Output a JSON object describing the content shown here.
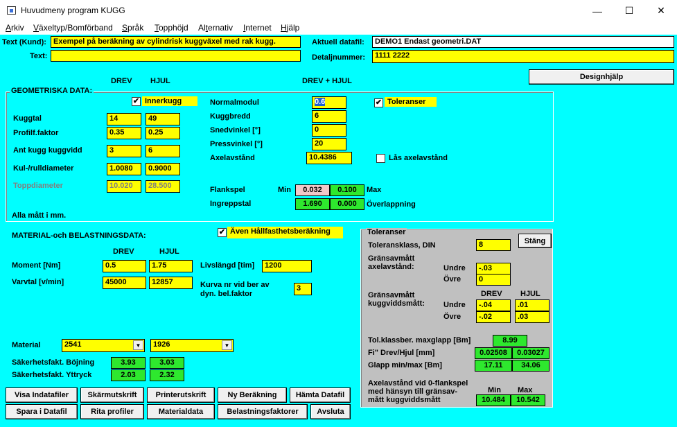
{
  "window": {
    "title": "Huvudmeny program KUGG",
    "minimize": "—",
    "maximize": "☐",
    "close": "✕"
  },
  "menu": [
    "Arkiv",
    "Växeltyp/Bomförband",
    "Språk",
    "Topphöjd",
    "Alternativ",
    "Internet",
    "Hjälp"
  ],
  "menu_underline": [
    "A",
    "V",
    "S",
    "T",
    "t",
    "I",
    "H"
  ],
  "header": {
    "text_kund_label": "Text (Kund):",
    "text_kund_value": "Exempel på beräkning av cylindrisk kuggväxel med rak kugg.",
    "text_label": "Text:",
    "text_value": "",
    "datafil_label": "Aktuell datafil:",
    "datafil_value": "DEMO1 Endast geometri.DAT",
    "detalj_label": "Detaljnummer:",
    "detalj_value": "1111 2222",
    "designhjalp": "Designhjälp"
  },
  "geometry": {
    "title": "GEOMETRISKA DATA:",
    "col_drev": "DREV",
    "col_hjul": "HJUL",
    "col_both": "DREV + HJUL",
    "innerkugg": {
      "label": "Innerkugg",
      "checked": "✔"
    },
    "rows": [
      {
        "label": "Kuggtal",
        "drev": "14",
        "hjul": "49"
      },
      {
        "label": "Profilf.faktor",
        "drev": "0.35",
        "hjul": "0.25"
      },
      {
        "label": "Ant kugg kuggvidd",
        "drev": "3",
        "hjul": "6"
      },
      {
        "label": "Kul-/rulldiameter",
        "drev": "1.0080",
        "hjul": "0.9000"
      },
      {
        "label": "Toppdiameter",
        "drev": "10.020",
        "hjul": "28.500"
      }
    ],
    "normalmodul_label": "Normalmodul",
    "normalmodul": "0.6",
    "kuggbredd_label": "Kuggbredd",
    "kuggbredd": "6",
    "snedvinkel_label": "Snedvinkel [°]",
    "snedvinkel": "0",
    "pressvinkel_label": "Pressvinkel [°]",
    "pressvinkel": "20",
    "axelavstand_label": "Axelavstånd",
    "axelavstand": "10.4386",
    "toleranser": {
      "label": "Toleranser",
      "checked": "✔"
    },
    "las_axel": {
      "label": "Lås axelavstånd",
      "checked": ""
    },
    "flankspel_label": "Flankspel",
    "min_label": "Min",
    "flankspel_min": "0.032",
    "flankspel_max": "0.100",
    "max_label": "Max",
    "ingreppstal_label": "Ingreppstal",
    "ingreppstal": "1.690",
    "overlapp": "0.000",
    "overlapp_label": "Överlappning",
    "alla_matt": "Alla mått i mm."
  },
  "material": {
    "title": "MATERIAL-och BELASTNINGSDATA:",
    "hallfasthet": {
      "label": "Även Hållfasthetsberäkning",
      "checked": "✔"
    },
    "col_drev": "DREV",
    "col_hjul": "HJUL",
    "moment_label": "Moment [Nm]",
    "moment_drev": "0.5",
    "moment_hjul": "1.75",
    "varvtal_label": "Varvtal [v/min]",
    "varvtal_drev": "45000",
    "varvtal_hjul": "12857",
    "livslangd_label": "Livslängd [tim]",
    "livslangd": "1200",
    "kurva_label1": "Kurva nr vid ber av",
    "kurva_label2": "dyn. bel.faktor",
    "kurva": "3",
    "material_label": "Material",
    "material_drev": "2541",
    "material_hjul": "1926",
    "bojning_label": "Säkerhetsfakt. Böjning",
    "bojning_drev": "3.93",
    "bojning_hjul": "3.03",
    "yttryck_label": "Säkerhetsfakt. Yttryck",
    "yttryck_drev": "2.03",
    "yttryck_hjul": "2.32"
  },
  "tolerances": {
    "title": "Toleranser",
    "klass_label": "Toleransklass, DIN",
    "klass": "8",
    "stang": "Stäng",
    "axel_label1": "Gränsavmått",
    "axel_label2": "axelavstånd:",
    "undre_label": "Undre",
    "ovre_label": "Övre",
    "axel_undre": "-.03",
    "axel_ovre": "0",
    "kugg_label1": "Gränsavmått",
    "kugg_label2": "kuggviddsmått:",
    "col_drev": "DREV",
    "col_hjul": "HJUL",
    "kugg_undre_drev": "-.04",
    "kugg_undre_hjul": ".01",
    "kugg_ovre_drev": "-.02",
    "kugg_ovre_hjul": ".03",
    "maxglapp_label": "Tol.klassber. maxglapp [Bm]",
    "maxglapp": "8.99",
    "fi_label": "Fi\"  Drev/Hjul [mm]",
    "fi_drev": "0.02508",
    "fi_hjul": "0.03027",
    "glapp_label": "Glapp min/max [Bm]",
    "glapp_min": "17.11",
    "glapp_max": "34.06",
    "axel0_l1": "Axelavstånd vid 0-flankspel",
    "axel0_l2": "med hänsyn till gränsav-",
    "axel0_l3": "mått kuggviddsmått",
    "min_label": "Min",
    "max_label": "Max",
    "axel0_min": "10.484",
    "axel0_max": "10.542"
  },
  "buttons": {
    "row1": [
      "Visa Indatafiler",
      "Skärmutskrift",
      "Printerutskrift",
      "Ny Beräkning",
      "Hämta Datafil"
    ],
    "row2": [
      "Spara i Datafil",
      "Rita profiler",
      "Materialdata",
      "Belastningsfaktorer",
      "Avsluta"
    ]
  },
  "colors": {
    "background": "#00ffff",
    "field": "#ffff00",
    "result": "#2ee82e",
    "panel": "#c0c0c0",
    "warning": "#f2c8c8"
  }
}
